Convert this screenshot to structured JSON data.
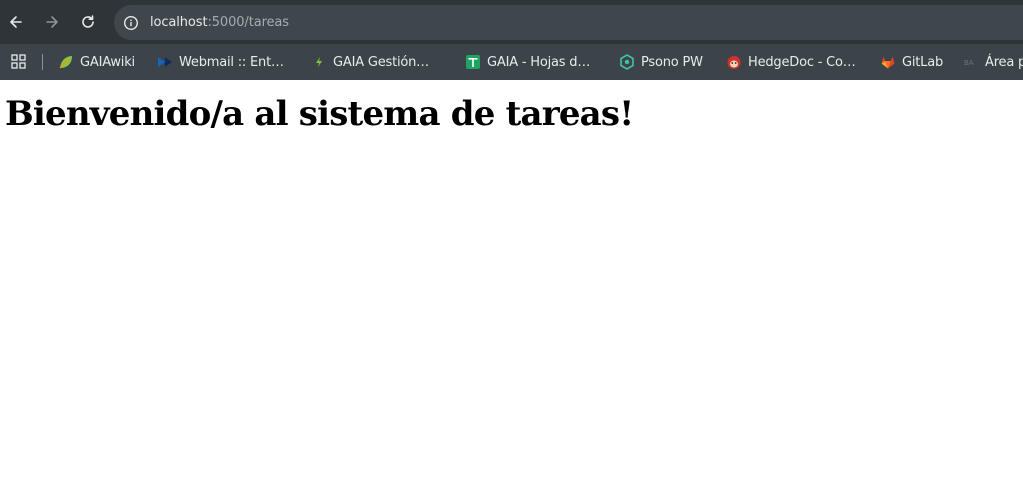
{
  "browser": {
    "url_host": "localhost",
    "url_path": ":5000/tareas",
    "bookmarks": [
      {
        "label": "GAIAwiki",
        "icon": "leaf-icon"
      },
      {
        "label": "Webmail :: Ent…",
        "icon": "webmail-icon"
      },
      {
        "label": "GAIA Gestión…",
        "icon": "gaia-gestion-icon"
      },
      {
        "label": "GAIA - Hojas d…",
        "icon": "sheets-icon"
      },
      {
        "label": "Psono PW",
        "icon": "psono-icon"
      },
      {
        "label": "HedgeDoc - Co…",
        "icon": "hedgedoc-icon"
      },
      {
        "label": "GitLab",
        "icon": "gitlab-icon"
      },
      {
        "label": "Área p",
        "icon": "area-icon"
      }
    ]
  },
  "page": {
    "heading": "Bienvenido/a al sistema de tareas!"
  }
}
